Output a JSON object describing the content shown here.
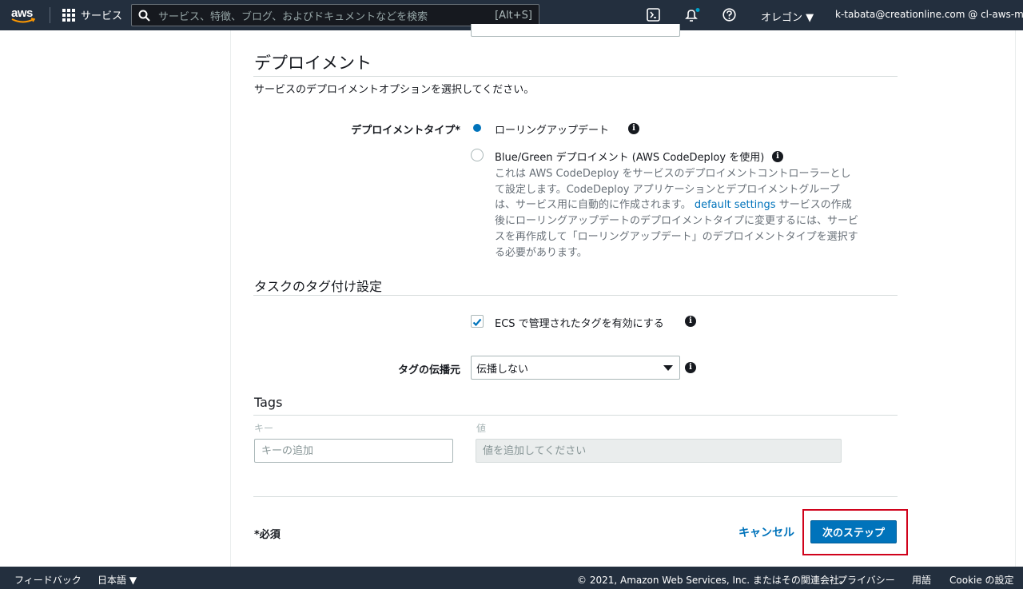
{
  "topnav": {
    "logo": "aws",
    "services_label": "サービス",
    "search_placeholder": "サービス、特徴、ブログ、およびドキュメントなどを検索",
    "search_shortcut": "[Alt+S]",
    "region": "オレゴン ▼",
    "account": "k-tabata@creationline.com @ cl-aws-ml ▼",
    "icons": [
      "grid-icon",
      "search-icon",
      "cloudshell-icon",
      "bell-icon",
      "help-icon"
    ]
  },
  "deployment": {
    "heading": "デプロイメント",
    "description": "サービスのデプロイメントオプションを選択してください。",
    "type_label": "デプロイメントタイプ*",
    "option_rolling": "ローリングアップデート",
    "option_bluegreen": "Blue/Green デプロイメント (AWS CodeDeploy を使用)",
    "help_part1": "これは AWS CodeDeploy をサービスのデプロイメントコントローラーとして設定します。CodeDeploy アプリケーションとデプロイメントグループは、サービス用に自動的に作成されます。 ",
    "help_link": "default settings",
    "help_part2": " サービスの作成後にローリングアップデートのデプロイメントタイプに変更するには、サービスを再作成して「ローリングアップデート」のデプロイメントタイプを選択する必要があります。",
    "selected": "rolling"
  },
  "tagging": {
    "heading": "タスクのタグ付け設定",
    "ecs_managed_tags_label": "ECS で管理されたタグを有効にする",
    "ecs_managed_tags_checked": true,
    "propagate_label": "タグの伝播元",
    "propagate_value": "伝播しない"
  },
  "tags": {
    "heading": "Tags",
    "key_header": "キー",
    "value_header": "値",
    "key_placeholder": "キーの追加",
    "value_placeholder": "値を追加してください"
  },
  "actions": {
    "required_note": "*必須",
    "cancel_label": "キャンセル",
    "next_label": "次のステップ"
  },
  "footer": {
    "feedback": "フィードバック",
    "language": "日本語 ▼",
    "copyright": "© 2021, Amazon Web Services, Inc. またはその関連会社。",
    "privacy": "プライバシー",
    "terms": "用語",
    "cookie": "Cookie の設定"
  },
  "colors": {
    "nav_bg": "#232f3e",
    "primary": "#0073bb",
    "highlight": "#d0021b"
  }
}
